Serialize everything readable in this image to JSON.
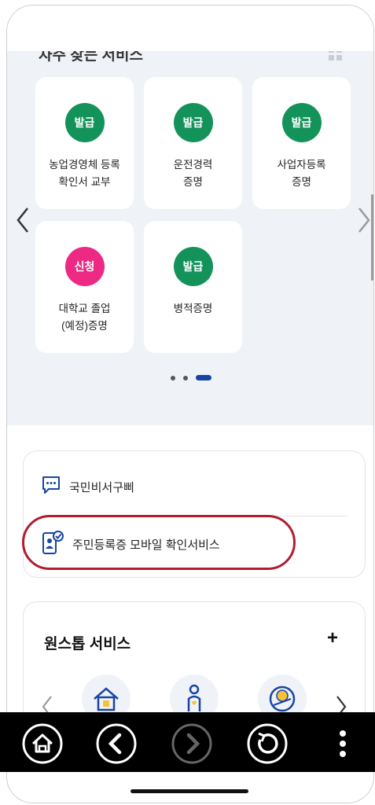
{
  "header": {
    "title_fragment": "자주 찾는 서비스"
  },
  "services": {
    "cards": [
      {
        "badge": "발급",
        "label": "농업경영체 등록\n확인서 교부",
        "color": "#13925a"
      },
      {
        "badge": "발급",
        "label": "운전경력\n증명",
        "color": "#13925a"
      },
      {
        "badge": "발급",
        "label": "사업자등록\n증명",
        "color": "#13925a"
      },
      {
        "badge": "신청",
        "label": "대학교 졸업\n(예정)증명",
        "color": "#ec2a84"
      },
      {
        "badge": "발급",
        "label": "병적증명",
        "color": "#13925a"
      }
    ],
    "page_indicator": {
      "total": 3,
      "current": 3
    }
  },
  "links": {
    "item1": "국민비서구삐",
    "item2": "주민등록증 모바일 확인서비스"
  },
  "onestop": {
    "title": "원스톱 서비스",
    "add_label": "+"
  },
  "colors": {
    "accent_blue": "#1745a5",
    "highlight_red": "#b01e2e",
    "bg_gray": "#eff2f6"
  },
  "icons": {
    "bottom_bar": [
      "home-icon",
      "back-icon",
      "forward-icon",
      "refresh-icon",
      "more-icon"
    ]
  }
}
